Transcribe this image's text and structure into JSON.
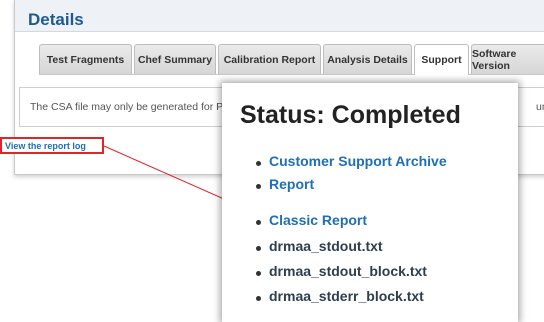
{
  "panel": {
    "title": "Details"
  },
  "tabs": [
    {
      "label": "Test Fragments",
      "active": false
    },
    {
      "label": "Chef Summary",
      "active": false
    },
    {
      "label": "Calibration Report",
      "active": false
    },
    {
      "label": "Analysis Details",
      "active": false
    },
    {
      "label": "Support",
      "active": true
    },
    {
      "label": "Software Version",
      "active": false
    }
  ],
  "support": {
    "csa_text": "The CSA file may only be generated for PG",
    "csa_text_tail": "umbna",
    "report_log_link": "View the report log"
  },
  "popup": {
    "status_title": "Status: Completed",
    "items": [
      {
        "label": "Customer Support Archive"
      },
      {
        "label": "Report"
      },
      {
        "label": "Classic Report"
      },
      {
        "label": "drmaa_stdout.txt"
      },
      {
        "label": "drmaa_stdout_block.txt"
      },
      {
        "label": "drmaa_stderr_block.txt"
      }
    ]
  },
  "colors": {
    "title_blue": "#1e5a91",
    "link_blue": "#1e6fb5",
    "highlight_red": "#e0242a",
    "text_dark": "#2d3e4f"
  }
}
